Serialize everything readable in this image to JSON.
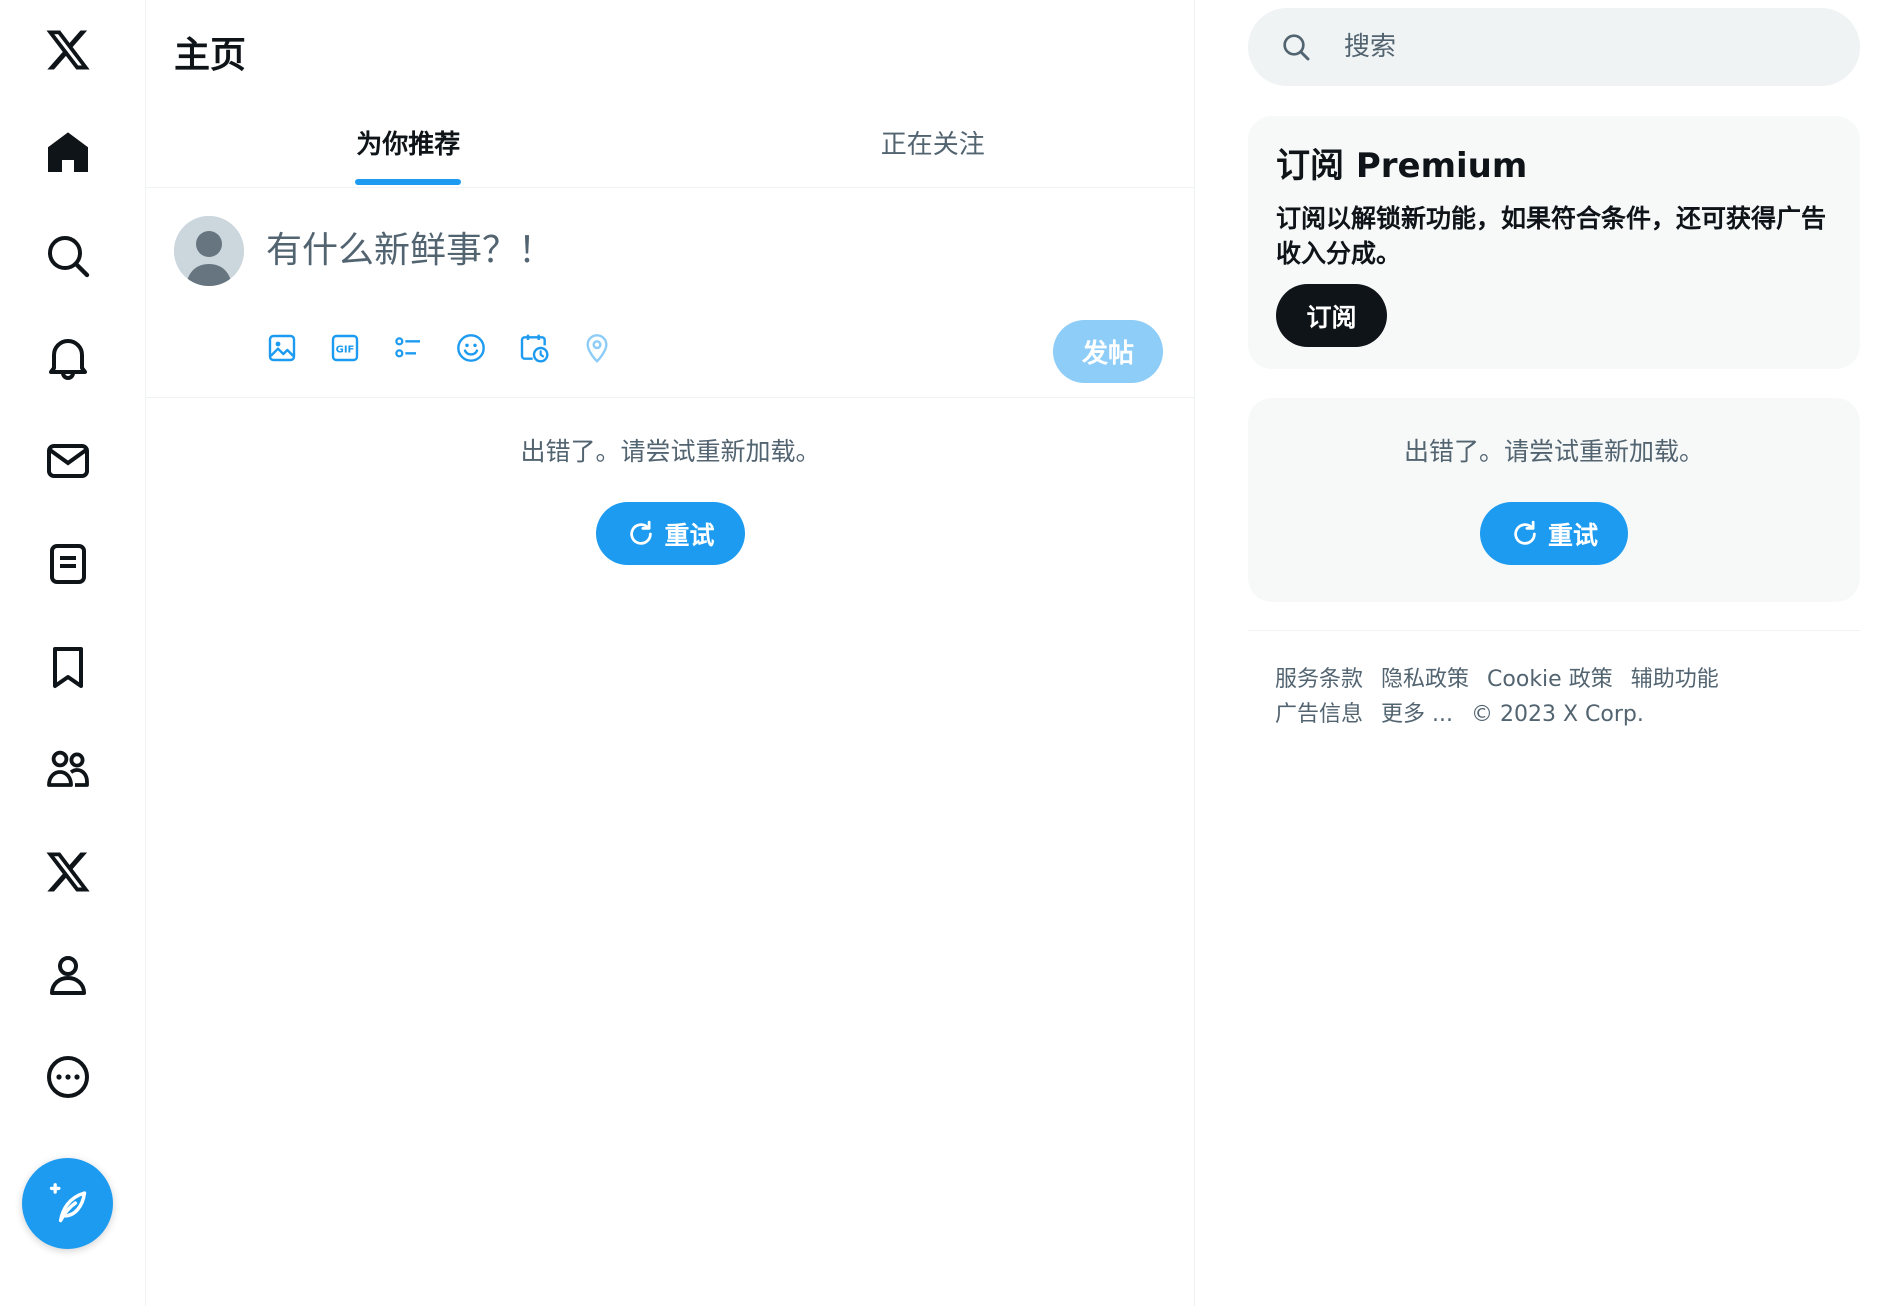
{
  "nav": {
    "items": [
      {
        "icon": "x-logo-icon"
      },
      {
        "icon": "home-icon"
      },
      {
        "icon": "explore-icon"
      },
      {
        "icon": "notifications-icon"
      },
      {
        "icon": "messages-icon"
      },
      {
        "icon": "lists-icon"
      },
      {
        "icon": "bookmarks-icon"
      },
      {
        "icon": "communities-icon"
      },
      {
        "icon": "premium-x-icon"
      },
      {
        "icon": "profile-icon"
      },
      {
        "icon": "more-icon"
      }
    ],
    "compose_icon": "compose-feather-icon"
  },
  "header": {
    "title": "主页"
  },
  "tabs": [
    {
      "label": "为你推荐",
      "active": true
    },
    {
      "label": "正在关注",
      "active": false
    }
  ],
  "composer": {
    "placeholder": "有什么新鲜事？！",
    "tools": [
      "image-icon",
      "gif-icon",
      "poll-icon",
      "emoji-icon",
      "schedule-icon",
      "location-icon"
    ],
    "post_label": "发帖"
  },
  "feed": {
    "error_text": "出错了。请尝试重新加载。",
    "retry_label": "重试"
  },
  "search": {
    "placeholder": "搜索"
  },
  "premium": {
    "title": "订阅 Premium",
    "description": "订阅以解锁新功能，如果符合条件，还可获得广告收入分成。",
    "button_label": "订阅"
  },
  "trends": {
    "error_text": "出错了。请尝试重新加载。",
    "retry_label": "重试"
  },
  "footer": {
    "links": [
      "服务条款",
      "隐私政策",
      "Cookie 政策",
      "辅助功能",
      "广告信息",
      "更多 ..."
    ],
    "copyright": "© 2023 X Corp."
  },
  "colors": {
    "accent": "#1d9bf0",
    "accent_disabled": "#8ecdf8",
    "text": "#0f1419",
    "muted": "#536471",
    "panel": "#f7f9f9"
  }
}
